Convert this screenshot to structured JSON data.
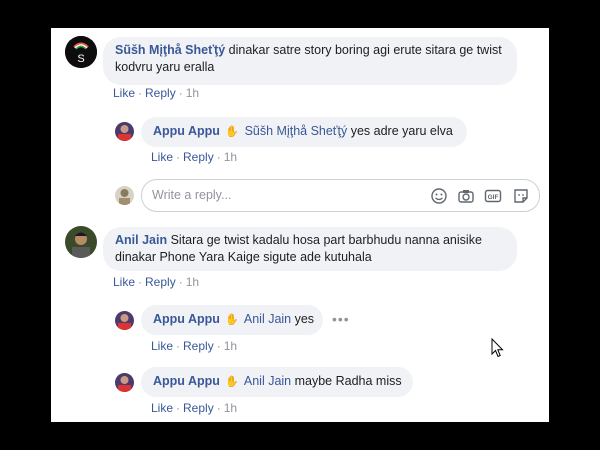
{
  "comments": [
    {
      "author": "Sũšh Mįţhå Sheťţý",
      "text": "dinakar satre story boring agi erute sitara ge twist kodvru yaru eralla",
      "actions": {
        "like": "Like",
        "reply": "Reply",
        "time": "1h"
      },
      "avatar_letter": "S",
      "replies": [
        {
          "author": "Appu Appu",
          "mention": "Sũšh Mįţhå Sheťţý",
          "text": "yes adre yaru elva",
          "actions": {
            "like": "Like",
            "reply": "Reply",
            "time": "1h"
          }
        }
      ]
    },
    {
      "author": "Anil Jain",
      "text": "Sitara ge twist kadalu hosa part barbhudu nanna anisike dinakar Phone Yara Kaige sigute ade kutuhala",
      "actions": {
        "like": "Like",
        "reply": "Reply",
        "time": "1h"
      },
      "replies": [
        {
          "author": "Appu Appu",
          "mention": "Anil Jain",
          "text": "yes",
          "actions": {
            "like": "Like",
            "reply": "Reply",
            "time": "1h"
          }
        },
        {
          "author": "Appu Appu",
          "mention": "Anil Jain",
          "text": "maybe Radha miss",
          "actions": {
            "like": "Like",
            "reply": "Reply",
            "time": "1h"
          }
        }
      ]
    }
  ],
  "reply_input": {
    "placeholder": "Write a reply..."
  },
  "icons": {
    "emoji": "emoji-icon",
    "camera": "camera-icon",
    "gif": "gif-icon",
    "sticker": "sticker-icon",
    "more": "more-options-icon",
    "wave": "wave-icon"
  },
  "more_glyph": "•••",
  "gif_label": "GIF",
  "colors": {
    "link": "#385898",
    "bubble": "#f0f2f5",
    "meta": "#90949c",
    "page_bg": "#000000"
  }
}
